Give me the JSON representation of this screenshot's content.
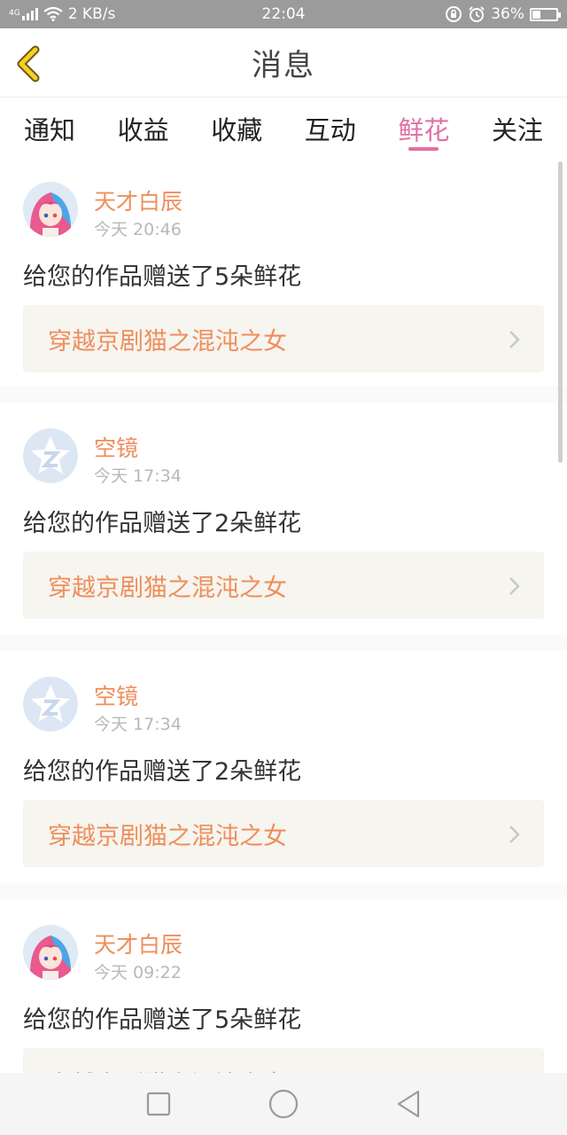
{
  "status_bar": {
    "network": "4G",
    "speed": "2 KB/s",
    "time": "22:04",
    "battery": "36%",
    "battery_level": 0.36,
    "icons": [
      "signal-icon",
      "wifi-icon",
      "rotation-lock-icon",
      "alarm-icon",
      "battery-icon"
    ]
  },
  "header": {
    "title": "消息",
    "back_icon": "chevron-left-icon"
  },
  "tabs": [
    {
      "label": "通知",
      "active": false
    },
    {
      "label": "收益",
      "active": false
    },
    {
      "label": "收藏",
      "active": false
    },
    {
      "label": "互动",
      "active": false
    },
    {
      "label": "鲜花",
      "active": true
    },
    {
      "label": "关注",
      "active": false
    }
  ],
  "messages": [
    {
      "user": "天才白辰",
      "time": "今天 20:46",
      "text": "给您的作品赠送了5朵鲜花",
      "work": "穿越京剧猫之混沌之女",
      "avatar": "anime-avatar"
    },
    {
      "user": "空镜",
      "time": "今天 17:34",
      "text": "给您的作品赠送了2朵鲜花",
      "work": "穿越京剧猫之混沌之女",
      "avatar": "default-star-avatar"
    },
    {
      "user": "空镜",
      "time": "今天 17:34",
      "text": "给您的作品赠送了2朵鲜花",
      "work": "穿越京剧猫之混沌之女",
      "avatar": "default-star-avatar"
    },
    {
      "user": "天才白辰",
      "time": "今天 09:22",
      "text": "给您的作品赠送了5朵鲜花",
      "work": "穿越京剧猫之混沌之女",
      "avatar": "anime-avatar"
    }
  ],
  "nav_bar": [
    "recent-apps-icon",
    "home-icon",
    "back-icon"
  ],
  "colors": {
    "accent": "#e36fa5",
    "orange": "#ef8e5b",
    "status_bar": "#9b9b9b",
    "card_bg": "#f6f5ef"
  }
}
